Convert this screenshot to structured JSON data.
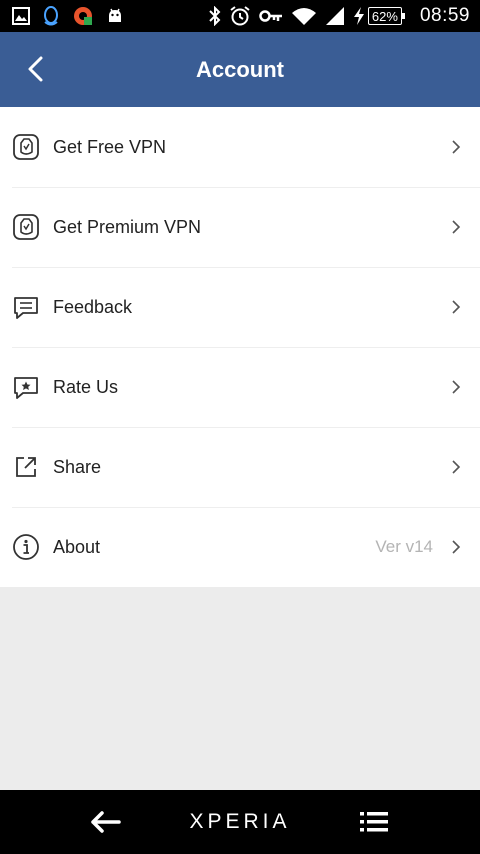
{
  "status_bar": {
    "time": "08:59",
    "battery_percent": "62%",
    "icons": [
      "gallery-icon",
      "qq-icon",
      "app-icon",
      "android-icon",
      "bluetooth-icon",
      "alarm-icon",
      "vpn-key-icon",
      "wifi-icon",
      "signal-icon",
      "charging-icon"
    ]
  },
  "header": {
    "title": "Account",
    "back_icon": "back-arrow-icon"
  },
  "menu": {
    "items": [
      {
        "label": "Get Free VPN",
        "icon": "vpn-shield-icon"
      },
      {
        "label": "Get Premium VPN",
        "icon": "vpn-shield-icon"
      },
      {
        "label": "Feedback",
        "icon": "message-icon"
      },
      {
        "label": "Rate Us",
        "icon": "rate-star-icon"
      },
      {
        "label": "Share",
        "icon": "share-icon"
      },
      {
        "label": "About",
        "icon": "info-icon",
        "value": "Ver v14"
      }
    ]
  },
  "nav_bar": {
    "brand": "XPERIA",
    "back_icon": "nav-back-icon",
    "menu_icon": "nav-menu-icon"
  },
  "colors": {
    "header_bg": "#3a5d95",
    "list_bg": "#ffffff",
    "page_bg": "#ececec",
    "text": "#222222",
    "muted_text": "#b4b4b4"
  }
}
